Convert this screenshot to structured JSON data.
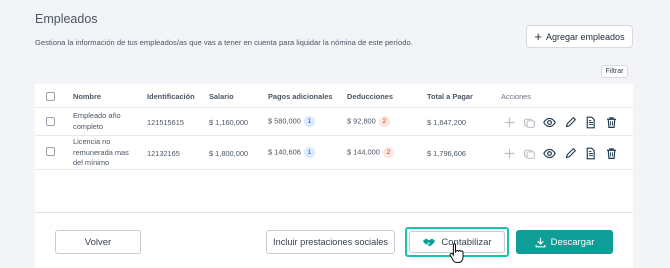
{
  "page": {
    "title": "Empleados",
    "subtitle": "Gestiona la información de tus empleados/as que vas a tener en cuenta para liquidar la nómina de este período.",
    "add_button_label": "Agregar empleados",
    "filter_label": "Filtrar"
  },
  "table": {
    "headers": {
      "nombre": "Nombre",
      "identificacion": "Identificación",
      "salario": "Salario",
      "pagos": "Pagos adicionales",
      "deducciones": "Deducciones",
      "total": "Total a Pagar",
      "acciones": "Acciones"
    },
    "rows": [
      {
        "nombre": "Empleado año completo",
        "identificacion": "121515615",
        "salario": "$ 1,160,000",
        "pagos": "$ 580,000",
        "pagos_badge": "1",
        "deducciones": "$ 92,800",
        "deducciones_badge": "2",
        "total": "$ 1,647,200"
      },
      {
        "nombre": "Licencia no remunerada mas del mínimo",
        "identificacion": "12132165",
        "salario": "$ 1,800,000",
        "pagos": "$ 140,606",
        "pagos_badge": "1",
        "deducciones": "$ 144,000",
        "deducciones_badge": "2",
        "total": "$ 1,796,606"
      }
    ],
    "action_icons": [
      "plus-icon",
      "copy-icon",
      "eye-icon",
      "pencil-icon",
      "document-icon",
      "trash-icon"
    ]
  },
  "footer": {
    "volver": "Volver",
    "incluir": "Incluir prestaciones sociales",
    "contabilizar": "Contabilizar",
    "descargar": "Descargar"
  },
  "colors": {
    "accent": "#0f9e97",
    "highlight": "#19c3b1",
    "icon": "#1f3a4d",
    "icon_disabled": "#b8bec8"
  }
}
